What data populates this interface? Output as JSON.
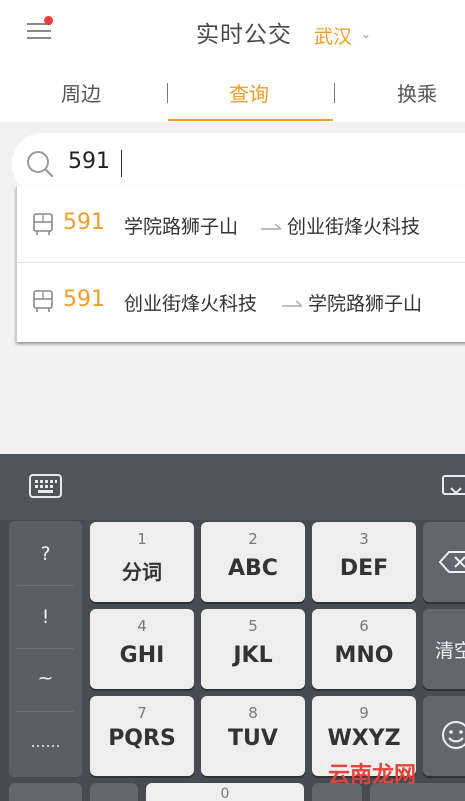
{
  "header": {
    "title": "实时公交",
    "city": "武汉",
    "city_chevron": "⌄"
  },
  "tabs": [
    {
      "label": "周边"
    },
    {
      "label": "查询"
    },
    {
      "label": "换乘"
    }
  ],
  "search": {
    "value": "591"
  },
  "suggestions": [
    {
      "route": "591",
      "from": "学院路狮子山",
      "to": "创业街烽火科技"
    },
    {
      "route": "591",
      "from": "创业街烽火科技",
      "to": "学院路狮子山"
    }
  ],
  "keyboard": {
    "symbols": [
      "?",
      "!",
      "~",
      "……"
    ],
    "keys": [
      {
        "num": "1",
        "label": "分词"
      },
      {
        "num": "2",
        "label": "ABC"
      },
      {
        "num": "3",
        "label": "DEF"
      },
      {
        "num": "4",
        "label": "GHI"
      },
      {
        "num": "5",
        "label": "JKL"
      },
      {
        "num": "6",
        "label": "MNO"
      },
      {
        "num": "7",
        "label": "PQRS"
      },
      {
        "num": "8",
        "label": "TUV"
      },
      {
        "num": "9",
        "label": "WXYZ"
      }
    ],
    "bottom_num": "0",
    "right_keys": [
      "清空"
    ]
  },
  "watermark": "云南龙网",
  "colors": {
    "accent": "#f39c27",
    "notification_dot": "#f13c3c",
    "keyboard_bg": "#474b52"
  }
}
